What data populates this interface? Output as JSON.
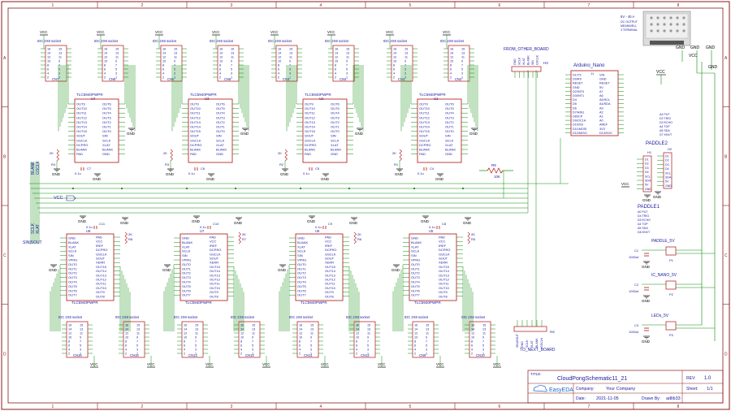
{
  "frame": {
    "col_labels": [
      "1",
      "2",
      "3",
      "4",
      "5",
      "6",
      "7",
      "8"
    ],
    "row_labels": [
      "A",
      "B",
      "C",
      "D"
    ]
  },
  "colors": {
    "border": "#8b1a1a",
    "wire": "#0a8a0a",
    "part": "#b01010",
    "pin": "#1a1aa0",
    "net": "#1a1aa0",
    "power": "#000000",
    "title": "#1a1aa0"
  },
  "power_labels": {
    "vcc": "VCC",
    "gnd": "GND"
  },
  "top_sockets": [
    {
      "ref": "CN7",
      "title": "IDC 2X8 socket"
    },
    {
      "ref": "CN8",
      "title": "IDC 2X8 socket"
    },
    {
      "ref": "CN5",
      "title": "IDC 2X8 socket"
    },
    {
      "ref": "CN6",
      "title": "IDC 2X8 socket"
    },
    {
      "ref": "CN3",
      "title": "IDC 2X8 socket"
    },
    {
      "ref": "CN4",
      "title": "IDC 2X8 socket"
    },
    {
      "ref": "CN1",
      "title": "IDC 2X8 socket"
    },
    {
      "ref": "CN2",
      "title": "IDC 2X8 socket"
    }
  ],
  "bottom_sockets": [
    {
      "ref": "CN16",
      "title": "IDC 2X8 socket"
    },
    {
      "ref": "CN15",
      "title": "IDC 2X8 socket"
    },
    {
      "ref": "CN13",
      "title": "IDC 2X8 socket"
    },
    {
      "ref": "CN14",
      "title": "IDC 2X8 socket"
    },
    {
      "ref": "CN11",
      "title": "IDC 2X8 socket"
    },
    {
      "ref": "CN12",
      "title": "IDC 2X8 socket"
    },
    {
      "ref": "CN9",
      "title": "IDC 2X8 socket"
    },
    {
      "ref": "CN10",
      "title": "IDC 2X8 socket"
    }
  ],
  "socket_pins_left": [
    "16",
    "14",
    "12",
    "10",
    "8",
    "6",
    "4",
    "2"
  ],
  "socket_pins_right": [
    "15",
    "13",
    "11",
    "9",
    "7",
    "5",
    "3",
    "1"
  ],
  "top_drivers": [
    {
      "ref": "U4",
      "part": "TLC5940PWPR",
      "cap": "C7",
      "res": "R4"
    },
    {
      "ref": "U3",
      "part": "TLC5940PWPR",
      "cap": "C6",
      "res": "R3"
    },
    {
      "ref": "U2",
      "part": "TLC5940PWPR",
      "cap": "C5",
      "res": "R2"
    },
    {
      "ref": "U1",
      "part": "TLC5940PWPR",
      "cap": "C4",
      "res": "R1"
    }
  ],
  "bottom_drivers": [
    {
      "ref": "U8",
      "part": "TLC5940PWPR",
      "cap": "C11",
      "res": "R8"
    },
    {
      "ref": "U7",
      "part": "TLC5940PWPR",
      "cap": "C10",
      "res": "R7"
    },
    {
      "ref": "U6",
      "part": "TLC5940PWPR",
      "cap": "C9",
      "res": "R6"
    },
    {
      "ref": "U5",
      "part": "TLC5940PWPR",
      "cap": "C8",
      "res": "R5"
    }
  ],
  "tlc_left_pins": [
    "OUT9",
    "OUT10",
    "OUT11",
    "OUT12",
    "OUT13",
    "OUT14",
    "OUT15",
    "SOUT",
    "GSCLK",
    "DCPRG",
    "BLANK",
    "PAD"
  ],
  "tlc_right_pins": [
    "OUT6",
    "OUT5",
    "OUT4",
    "OUT3",
    "OUT2",
    "OUT1",
    "OUT0",
    "SIN",
    "SCLK",
    "XLAT",
    "BLANK",
    "GND"
  ],
  "tlc_bottom_left_pins": [
    "GND",
    "BLANK",
    "XLAT",
    "SCLK",
    "SIN",
    "VPRG",
    "OUT0",
    "OUT1",
    "OUT2",
    "OUT3",
    "OUT4",
    "OUT5",
    "OUT6",
    "OUT7"
  ],
  "tlc_bottom_right_pins": [
    "PAD",
    "VCC",
    "IREF",
    "DCPRG",
    "GSCLK",
    "SOUT",
    "XERR",
    "OUT15",
    "OUT14",
    "OUT13",
    "OUT12",
    "OUT11",
    "OUT10",
    "OUT9",
    "OUT8"
  ],
  "component_values": {
    "res_2k": "2K",
    "cap_01u": "0.1u",
    "r9_ref": "R9",
    "r9_val": "10K"
  },
  "net_labels": {
    "blank": "BLANK",
    "gsclk": "GSCLK",
    "vcc": "VCC",
    "sclk": "SCLK",
    "xlat": "XLAT",
    "sin_sout": "SIN|SOUT"
  },
  "from_other_board": {
    "label": "FROM_OTHER_BOARD",
    "ref": "H3",
    "pins": [
      "GND",
      "SCLK",
      "XLAT",
      "BLANK",
      "SIN",
      "GSCLK"
    ]
  },
  "to_next_board": {
    "label": "TO_NEXT_BOARD",
    "ref": "H4",
    "pins": [
      "SIN|SOUT",
      "GND",
      "SCLK",
      "XLAT",
      "BLANK",
      "GSCLK"
    ]
  },
  "arduino": {
    "title": "Arduino_Nano",
    "ref": "J1",
    "left_pins": [
      "D1/TX",
      "D0/RX",
      "RESET",
      "GND",
      "D2/INT0",
      "D3/INT1",
      "D4",
      "D5",
      "D6",
      "D7/AIN1",
      "D8/ICP",
      "D9/OC1A",
      "D10/SS",
      "D11/MOSI",
      "D12/MISO"
    ],
    "right_pins": [
      "VIN",
      "GND",
      "RESET",
      "5V",
      "A7",
      "A6",
      "A5/SCL",
      "A4/SDA",
      "A3",
      "A2",
      "A1",
      "A0",
      "AREF",
      "3V3",
      "D13/SCK"
    ]
  },
  "psu": {
    "lines": [
      "5V - 40 A",
      "DC OUTPUT",
      "MEANWELL",
      "3 TERMINAL"
    ]
  },
  "paddle2": {
    "title": "PADDLE2",
    "ref": "H2",
    "notes": [
      "A4 PUT",
      "D2 TRIG",
      "D3 ECHO",
      "A4 TOP",
      "A5 SDA",
      "D7 KNVT"
    ],
    "pins": [
      "D1",
      "D2",
      "D3",
      "D4",
      "SCL",
      "SDA",
      "5V",
      "GND"
    ]
  },
  "paddle1": {
    "title": "PADDLE1",
    "ref": "H1",
    "notes": [
      "A0 PUT",
      "D4 TRIG",
      "D5 ECHO",
      "A4 TOP",
      "A5 SDA",
      "D8 KNVT"
    ],
    "pins": [
      "D1",
      "D2",
      "D3",
      "D4",
      "SCL",
      "SDA",
      "5V",
      "GND"
    ]
  },
  "power_rails": [
    {
      "label": "PADDLE_5V",
      "ref": "P1",
      "cap": "C1",
      "cap_val": "1000uf"
    },
    {
      "label": "IC_NANO_5V",
      "ref": "P2",
      "cap": "C2",
      "cap_val": "1000uf"
    },
    {
      "label": "LEDs_5V",
      "ref": "P3",
      "cap": "C3",
      "cap_val": "1000uf"
    }
  ],
  "title_block": {
    "title_label": "TITLE:",
    "title": "CloudPongSchematic11_21",
    "rev_label": "REV:",
    "rev": "1.0",
    "logo": "EasyEDA",
    "company_label": "Company:",
    "company": "Your Company",
    "sheet_label": "Sheet:",
    "sheet": "1/1",
    "date_label": "Date:",
    "date": "2021-11-05",
    "drawn_label": "Drawn By:",
    "drawn": "adlib33"
  }
}
